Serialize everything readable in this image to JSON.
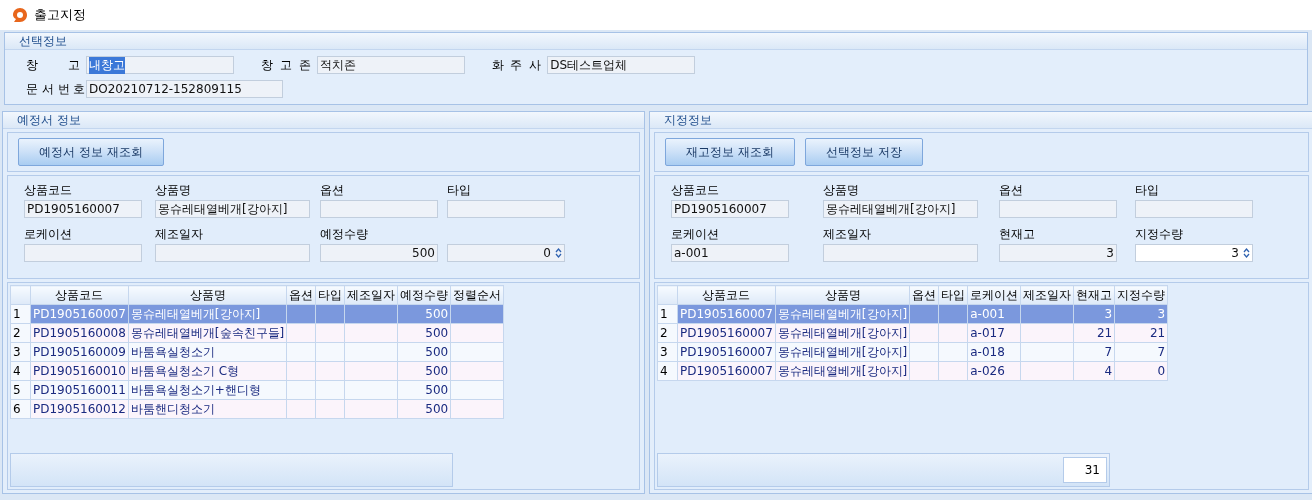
{
  "window": {
    "title": "출고지정"
  },
  "selection_info": {
    "title": "선택정보",
    "rows": [
      [
        {
          "label": "창 고",
          "value": "내창고",
          "highlighted": true
        },
        {
          "label": "창 고 존",
          "value": "적치존",
          "highlighted": false
        },
        {
          "label": "화 주 사",
          "value": "DS테스트업체",
          "highlighted": false
        }
      ],
      [
        {
          "label": "문 서 번 호",
          "value": "DO20210712-152809115",
          "highlighted": false
        }
      ]
    ]
  },
  "panels": [
    {
      "title": "예정서 정보",
      "buttons": [
        "예정서 정보 재조회"
      ],
      "form": [
        {
          "kind": "text",
          "label": "상품코드",
          "value": "PD1905160007"
        },
        {
          "kind": "text",
          "label": "상품명",
          "value": "몽슈레태열베개[강아지]"
        },
        {
          "kind": "text",
          "label": "옵션"
        },
        {
          "kind": "text",
          "label": "타입"
        },
        {
          "kind": "text",
          "label": "로케이션"
        },
        {
          "kind": "text",
          "label": "제조일자"
        },
        {
          "kind": "number",
          "label": "예정수량",
          "value": "500"
        },
        {
          "kind": "spin",
          "value": "0",
          "editable": false
        }
      ],
      "table": {
        "columns": [
          "상품코드",
          "상품명",
          "옵션",
          "타입",
          "제조일자",
          "예정수량",
          "정렬순서"
        ],
        "rows": [
          {
            "number": "1",
            "selected": true,
            "cells": [
              "PD1905160007",
              "몽슈레태열베개[강아지]",
              null,
              null,
              null,
              "500",
              null
            ]
          },
          {
            "number": "2",
            "selected": false,
            "cells": [
              "PD1905160008",
              "몽슈레태열베개[숲속친구들]",
              null,
              null,
              null,
              "500",
              null
            ]
          },
          {
            "number": "3",
            "selected": false,
            "cells": [
              "PD1905160009",
              "바툼욕실청소기",
              null,
              null,
              null,
              "500",
              null
            ]
          },
          {
            "number": "4",
            "selected": false,
            "cells": [
              "PD1905160010",
              "바툼욕실청소기 C형",
              null,
              null,
              null,
              "500",
              null
            ]
          },
          {
            "number": "5",
            "selected": false,
            "cells": [
              "PD1905160011",
              "바툼욕실청소기+핸디형",
              null,
              null,
              null,
              "500",
              null
            ]
          },
          {
            "number": "6",
            "selected": false,
            "cells": [
              "PD1905160012",
              "바툼핸디청소기",
              null,
              null,
              null,
              "500",
              null
            ]
          }
        ]
      }
    },
    {
      "title": "지정정보",
      "buttons": [
        "재고정보 재조회",
        "선택정보 저장"
      ],
      "form": [
        {
          "kind": "text",
          "label": "상품코드",
          "value": "PD1905160007"
        },
        {
          "kind": "text",
          "label": "상품명",
          "value": "몽슈레태열베개[강아지]"
        },
        {
          "kind": "text",
          "label": "옵션"
        },
        {
          "kind": "text",
          "label": "타입"
        },
        {
          "kind": "text",
          "label": "로케이션",
          "value": "a-001"
        },
        {
          "kind": "text",
          "label": "제조일자"
        },
        {
          "kind": "number",
          "label": "현재고",
          "value": "3"
        },
        {
          "kind": "spin",
          "label": "지정수량",
          "value": "3",
          "editable": true
        }
      ],
      "table": {
        "columns": [
          "상품코드",
          "상품명",
          "옵션",
          "타입",
          "로케이션",
          "제조일자",
          "현재고",
          "지정수량"
        ],
        "rows": [
          {
            "number": "1",
            "selected": true,
            "cells": [
              "PD1905160007",
              "몽슈레태열베개[강아지]",
              null,
              null,
              "a-001",
              null,
              "3",
              "3"
            ]
          },
          {
            "number": "2",
            "selected": false,
            "cells": [
              "PD1905160007",
              "몽슈레태열베개[강아지]",
              null,
              null,
              "a-017",
              null,
              "21",
              "21"
            ]
          },
          {
            "number": "3",
            "selected": false,
            "cells": [
              "PD1905160007",
              "몽슈레태열베개[강아지]",
              null,
              null,
              "a-018",
              null,
              "7",
              "7"
            ]
          },
          {
            "number": "4",
            "selected": false,
            "cells": [
              "PD1905160007",
              "몽슈레태열베개[강아지]",
              null,
              null,
              "a-026",
              null,
              "4",
              "0"
            ]
          }
        ],
        "total": "31"
      }
    }
  ]
}
